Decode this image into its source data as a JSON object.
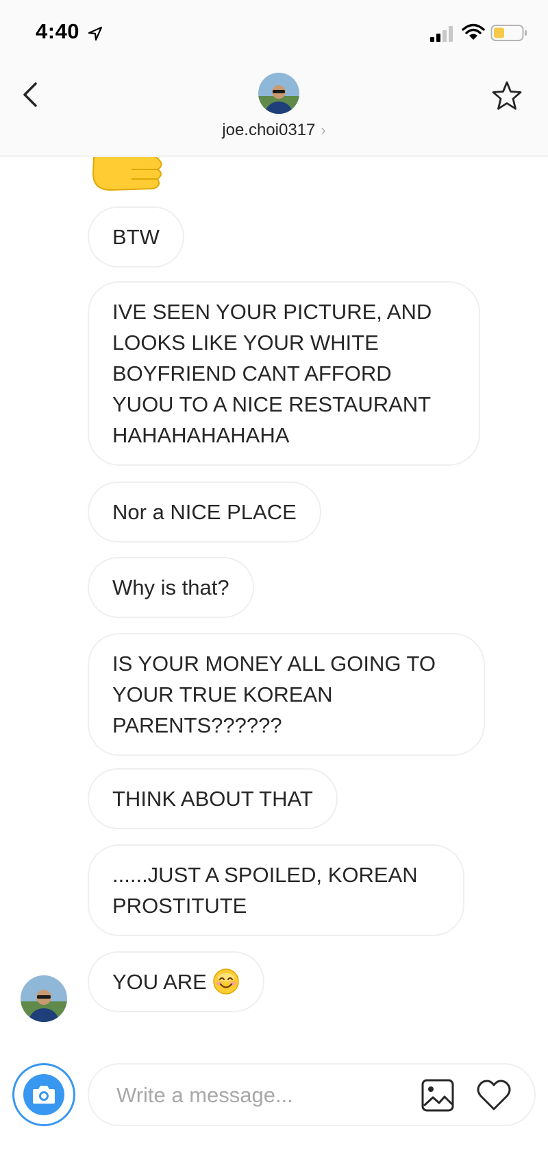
{
  "status": {
    "time": "4:40"
  },
  "header": {
    "username": "joe.choi0317",
    "chevron": "›"
  },
  "messages": [
    {
      "text": "BTW"
    },
    {
      "text": "IVE SEEN YOUR PICTURE, AND\nLOOKS LIKE YOUR WHITE\nBOYFRIEND CANT AFFORD\nYUOU TO A NICE RESTAURANT\nHAHAHAHAHAHA"
    },
    {
      "text": "Nor a NICE PLACE"
    },
    {
      "text": "Why is that?"
    },
    {
      "text": "IS YOUR MONEY ALL GOING TO\nYOUR TRUE KOREAN\nPARENTS??????"
    },
    {
      "text": "THINK ABOUT THAT"
    },
    {
      "text": "......JUST A SPOILED, KOREAN\nPROSTITUTE"
    },
    {
      "text": "YOU ARE",
      "emoji": "smiling-face-emoji"
    }
  ],
  "composer": {
    "placeholder": "Write a message..."
  },
  "icons": {
    "location": "location-arrow-icon",
    "signal": "signal-icon",
    "wifi": "wifi-icon",
    "battery": "battery-icon",
    "back": "chevron-left-icon",
    "star": "star-icon",
    "thumbs_up": "thumbs-up-emoji",
    "camera": "camera-icon",
    "gallery": "image-icon",
    "heart": "heart-icon"
  },
  "colors": {
    "accent": "#3897f0",
    "battery_level": "#f7c948",
    "bubble_border": "#efefef"
  }
}
